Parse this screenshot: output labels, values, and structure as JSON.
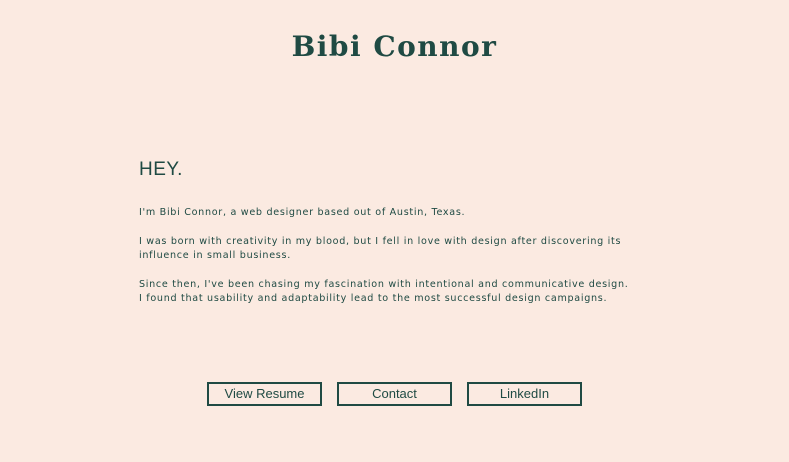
{
  "header": {
    "title": "Bibi Connor"
  },
  "main": {
    "greeting": "HEY.",
    "paragraphs": [
      "I'm Bibi Connor, a web designer based out of Austin, Texas.",
      "I was born with creativity in my blood, but I fell in love with design after discovering its influence in small business.",
      "Since then, I've been chasing my fascination with intentional and communicative design. I found that usability and adaptability lead to the most successful design campaigns."
    ]
  },
  "actions": {
    "resume_label": "View Resume",
    "contact_label": "Contact",
    "linkedin_label": "LinkedIn"
  },
  "colors": {
    "background": "#FBEAE1",
    "text": "#1F4A43"
  }
}
